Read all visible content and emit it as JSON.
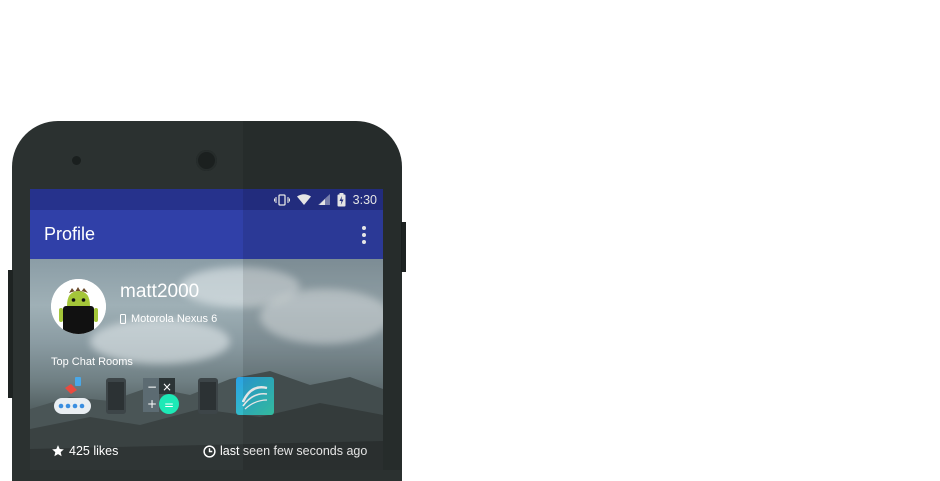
{
  "status_bar": {
    "time": "3:30",
    "icons": [
      "vibrate-icon",
      "wifi-icon",
      "signal-icon",
      "battery-charging-icon"
    ]
  },
  "app_bar": {
    "title": "Profile",
    "menu_icon": "more-vert-icon"
  },
  "profile": {
    "username": "matt2000",
    "device": "Motorola Nexus 6",
    "device_icon": "phone-icon",
    "avatar_icon": "android-avatar-icon"
  },
  "top_chat_rooms": {
    "label": "Top Chat Rooms",
    "rooms": [
      {
        "icon": "bluetooth-keyboard-app-icon"
      },
      {
        "icon": "phone-device-icon"
      },
      {
        "icon": "calculator-app-icon"
      },
      {
        "icon": "phone-device-icon"
      },
      {
        "icon": "swiftkey-app-icon"
      }
    ]
  },
  "stats": {
    "likes": "425 likes",
    "likes_icon": "star-icon",
    "last_seen": "last seen few seconds ago",
    "last_seen_icon": "clock-icon"
  },
  "colors": {
    "status_bar": "#26328c",
    "app_bar": "#3040a8",
    "phone_body": "#2b3130"
  }
}
